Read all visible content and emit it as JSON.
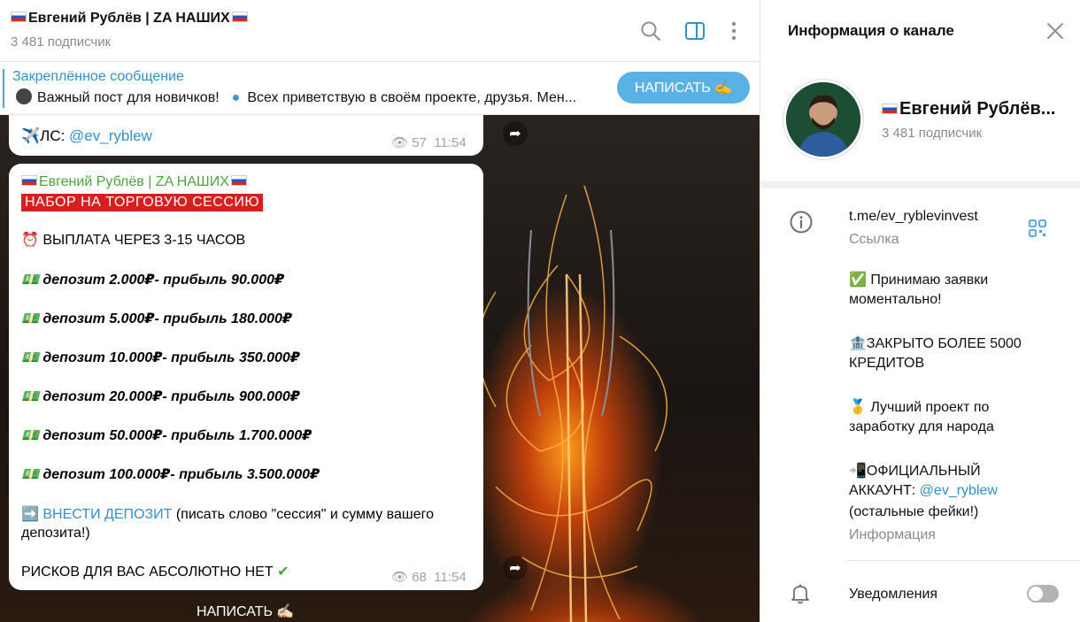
{
  "header": {
    "title": "Евгений Рублёв | ZA НАШИХ",
    "subscribers": "3 481 подписчик"
  },
  "pinned": {
    "title": "Закреплённое сообщение",
    "preview": "Важный пост для новичков!",
    "preview2": "Всех приветствую в своём проекте, друзья. Мен...",
    "write_button": "НАПИСАТЬ ✍"
  },
  "message1": {
    "prefix": "✈️ЛС: ",
    "link": "@ev_ryblew",
    "views": "57",
    "time": "11:54"
  },
  "message2": {
    "sender": "Евгений Рублёв | ZA НАШИХ",
    "banner": "НАБОР НА ТОРГОВУЮ СЕССИЮ",
    "payout": "⏰ ВЫПЛАТА ЧЕРЕЗ 3-15 ЧАСОВ",
    "deposits": [
      "депозит 2.000₽- прибыль 90.000₽",
      "депозит 5.000₽- прибыль 180.000₽",
      "депозит 10.000₽- прибыль 350.000₽",
      "депозит 20.000₽- прибыль 900.000₽",
      "депозит 50.000₽- прибыль 1.700.000₽",
      "депозит 100.000₽- прибыль 3.500.000₽"
    ],
    "cta_link": "➡️ ВНЕСТИ ДЕПОЗИТ",
    "cta_text": " (писать слово \"сессия\" и сумму вашего",
    "cta_text2": "депозита!)",
    "footer": "РИСКОВ ДЛЯ ВАС АБСОЛЮТНО НЕТ",
    "footer_check": "✔",
    "views": "68",
    "time": "11:54"
  },
  "bottom_write": "НАПИСАТЬ ✍🏻",
  "panel": {
    "title": "Информация о канале",
    "name": "Евгений Рублёв...",
    "subscribers": "3 481 подписчик",
    "link": "t.me/ev_ryblevinvest",
    "link_label": "Ссылка",
    "desc": [
      "✅ Принимаю заявки",
      "моментально!",
      "🏦ЗАКРЫТО БОЛЕЕ 5000",
      "КРЕДИТОВ",
      "🥇 Лучший проект по",
      "заработку для народа",
      "📲ОФИЦИАЛЬНЫЙ",
      "АККАУНТ: ",
      "@ev_ryblew",
      "(остальные фейки!)"
    ],
    "desc_label": "Информация",
    "notifications": "Уведомления"
  },
  "icons": {
    "search": "search-icon",
    "sidebar": "sidebar-toggle-icon",
    "more": "more-icon",
    "info": "info-icon",
    "qr": "qr-code-icon",
    "bell": "bell-icon",
    "close": "close-icon",
    "eye": "eye-icon",
    "forward": "forward-icon"
  },
  "colors": {
    "accent": "#3390c9",
    "write_button": "#5ab1e6",
    "banner": "#d61f1f",
    "sender": "#4aa63a"
  }
}
